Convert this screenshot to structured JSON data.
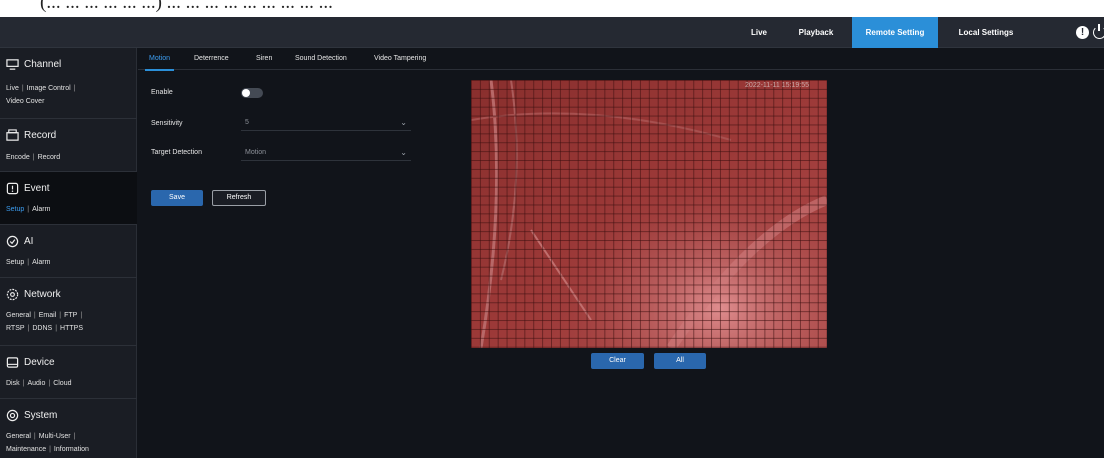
{
  "caption_fragment": "(... ... ... ... ... ...) ... ... ... ... ... ... ... ... ...",
  "top_nav": {
    "items": [
      {
        "label": "Live"
      },
      {
        "label": "Playback"
      },
      {
        "label": "Remote Setting",
        "active": true
      },
      {
        "label": "Local Settings"
      }
    ]
  },
  "sidebar": {
    "channel": {
      "title": "Channel",
      "links": [
        "Live",
        "Image Control",
        "Video Cover"
      ]
    },
    "record": {
      "title": "Record",
      "links": [
        "Encode",
        "Record"
      ]
    },
    "event": {
      "title": "Event",
      "links": [
        "Setup",
        "Alarm"
      ]
    },
    "ai": {
      "title": "AI",
      "links": [
        "Setup",
        "Alarm"
      ]
    },
    "network": {
      "title": "Network",
      "links": [
        "General",
        "Email",
        "FTP",
        "RTSP",
        "DDNS",
        "HTTPS"
      ]
    },
    "device": {
      "title": "Device",
      "links": [
        "Disk",
        "Audio",
        "Cloud"
      ]
    },
    "system": {
      "title": "System",
      "links": [
        "General",
        "Multi-User",
        "Maintenance",
        "Information"
      ]
    }
  },
  "tabs": [
    "Motion",
    "Deterrence",
    "Siren",
    "Sound Detection",
    "Video Tampering"
  ],
  "form": {
    "enable_label": "Enable",
    "enable_on": false,
    "sensitivity_label": "Sensitivity",
    "sensitivity_value": "5",
    "target_label": "Target Detection",
    "target_value": "Motion"
  },
  "buttons": {
    "save": "Save",
    "refresh": "Refresh",
    "clear": "Clear",
    "all": "All"
  },
  "video": {
    "timestamp": "2022-11-11 15:19:55"
  },
  "colors": {
    "accent": "#2b8fd8",
    "active_link": "#3c9df0",
    "motion_overlay": "#be2828"
  }
}
